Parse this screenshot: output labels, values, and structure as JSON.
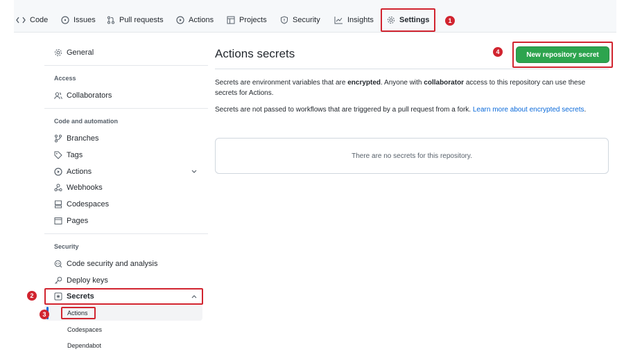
{
  "nav": {
    "tabs": [
      {
        "label": "Code",
        "icon": "code-icon"
      },
      {
        "label": "Issues",
        "icon": "issue-icon"
      },
      {
        "label": "Pull requests",
        "icon": "pull-request-icon"
      },
      {
        "label": "Actions",
        "icon": "play-icon"
      },
      {
        "label": "Projects",
        "icon": "table-icon"
      },
      {
        "label": "Security",
        "icon": "shield-icon"
      },
      {
        "label": "Insights",
        "icon": "graph-icon"
      },
      {
        "label": "Settings",
        "icon": "gear-icon",
        "active": true
      }
    ]
  },
  "sidebar": {
    "general": "General",
    "access_heading": "Access",
    "collaborators": "Collaborators",
    "code_automation_heading": "Code and automation",
    "branches": "Branches",
    "tags": "Tags",
    "actions": "Actions",
    "webhooks": "Webhooks",
    "codespaces": "Codespaces",
    "pages": "Pages",
    "security_heading": "Security",
    "code_security": "Code security and analysis",
    "deploy_keys": "Deploy keys",
    "secrets": "Secrets",
    "secrets_sub": [
      "Actions",
      "Codespaces",
      "Dependabot"
    ]
  },
  "main": {
    "title": "Actions secrets",
    "new_button": "New repository secret",
    "para1_a": "Secrets are environment variables that are ",
    "para1_b": "encrypted",
    "para1_c": ". Anyone with ",
    "para1_d": "collaborator",
    "para1_e": " access to this repository can use these secrets for Actions.",
    "para2_a": "Secrets are not passed to workflows that are triggered by a pull request from a fork. ",
    "para2_link": "Learn more about encrypted secrets",
    "para2_end": ".",
    "empty_text": "There are no secrets for this repository."
  },
  "annotations": {
    "colors": {
      "annotation": "#d1242f",
      "accent_green": "#2da44e",
      "link": "#0969da"
    },
    "numbers": [
      "1",
      "2",
      "3",
      "4"
    ]
  }
}
